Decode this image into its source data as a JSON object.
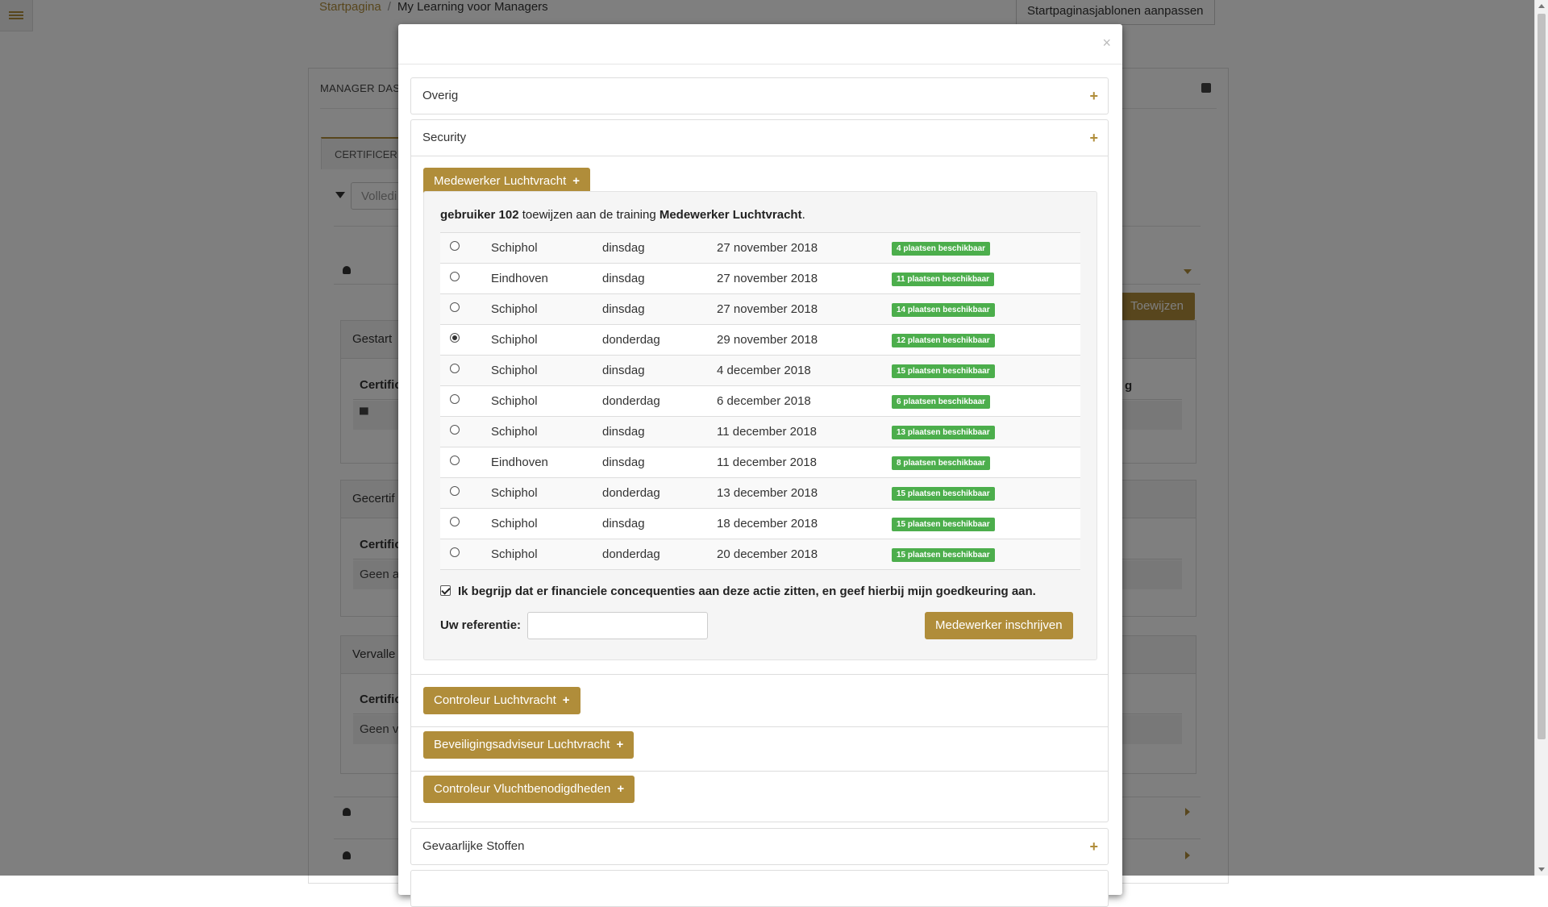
{
  "breadcrumb": {
    "home": "Startpagina",
    "separator": "/",
    "current": "My Learning voor Managers"
  },
  "header": {
    "customize_label": "Startpaginasjablonen aanpassen"
  },
  "background": {
    "panel_title": "MANAGER DAS",
    "tab_label": "CERTIFICERIN",
    "filter_placeholder": "Volledi",
    "assign_button": "Toewijzen",
    "box_started": "Gestart",
    "box_certified": "Gecertif",
    "box_expired": "Vervalle",
    "table_head": "Certific",
    "table_head_right": "g",
    "empty_certified": "Geen a",
    "empty_expired": "Geen v"
  },
  "modal": {
    "close_label": "×",
    "sections": {
      "overig": "Overig",
      "security": "Security",
      "gevaarlijke": "Gevaarlijke Stoffen"
    },
    "training_buttons": [
      "Medewerker Luchtvracht",
      "Controleur Luchtvracht",
      "Beveiligingsadviseur Luchtvracht",
      "Controleur Vluchtbenodigdheden"
    ],
    "plus": "+",
    "assign": {
      "user": "gebruiker 102",
      "middle": " toewijzen aan de training ",
      "training": "Medewerker Luchtvracht",
      "end": "."
    },
    "sessions": [
      {
        "location": "Schiphol",
        "day": "dinsdag",
        "date": "27 november 2018",
        "availability": "4 plaatsen beschikbaar",
        "selected": false
      },
      {
        "location": "Eindhoven",
        "day": "dinsdag",
        "date": "27 november 2018",
        "availability": "11 plaatsen beschikbaar",
        "selected": false
      },
      {
        "location": "Schiphol",
        "day": "dinsdag",
        "date": "27 november 2018",
        "availability": "14 plaatsen beschikbaar",
        "selected": false
      },
      {
        "location": "Schiphol",
        "day": "donderdag",
        "date": "29 november 2018",
        "availability": "12 plaatsen beschikbaar",
        "selected": true
      },
      {
        "location": "Schiphol",
        "day": "dinsdag",
        "date": "4 december 2018",
        "availability": "15 plaatsen beschikbaar",
        "selected": false
      },
      {
        "location": "Schiphol",
        "day": "donderdag",
        "date": "6 december 2018",
        "availability": "6 plaatsen beschikbaar",
        "selected": false
      },
      {
        "location": "Schiphol",
        "day": "dinsdag",
        "date": "11 december 2018",
        "availability": "13 plaatsen beschikbaar",
        "selected": false
      },
      {
        "location": "Eindhoven",
        "day": "dinsdag",
        "date": "11 december 2018",
        "availability": "8 plaatsen beschikbaar",
        "selected": false
      },
      {
        "location": "Schiphol",
        "day": "donderdag",
        "date": "13 december 2018",
        "availability": "15 plaatsen beschikbaar",
        "selected": false
      },
      {
        "location": "Schiphol",
        "day": "dinsdag",
        "date": "18 december 2018",
        "availability": "15 plaatsen beschikbaar",
        "selected": false
      },
      {
        "location": "Schiphol",
        "day": "donderdag",
        "date": "20 december 2018",
        "availability": "15 plaatsen beschikbaar",
        "selected": false
      }
    ],
    "consent_text": "Ik begrijp dat er financiele concequenties aan deze actie zitten, en geef hierbij mijn goedkeuring aan.",
    "consent_checked": true,
    "reference_label": "Uw referentie:",
    "reference_value": "",
    "enroll_button": "Medewerker inschrijven"
  },
  "colors": {
    "accent": "#b08d3a",
    "badge": "#4cae4c",
    "overlay": "rgba(0,0,0,0.5)"
  },
  "icons": [
    "menu-icon",
    "filter-icon",
    "user-icon",
    "graduation-cap-icon",
    "close-icon",
    "plus-icon",
    "caret-down-icon",
    "caret-right-icon",
    "minus-icon"
  ]
}
